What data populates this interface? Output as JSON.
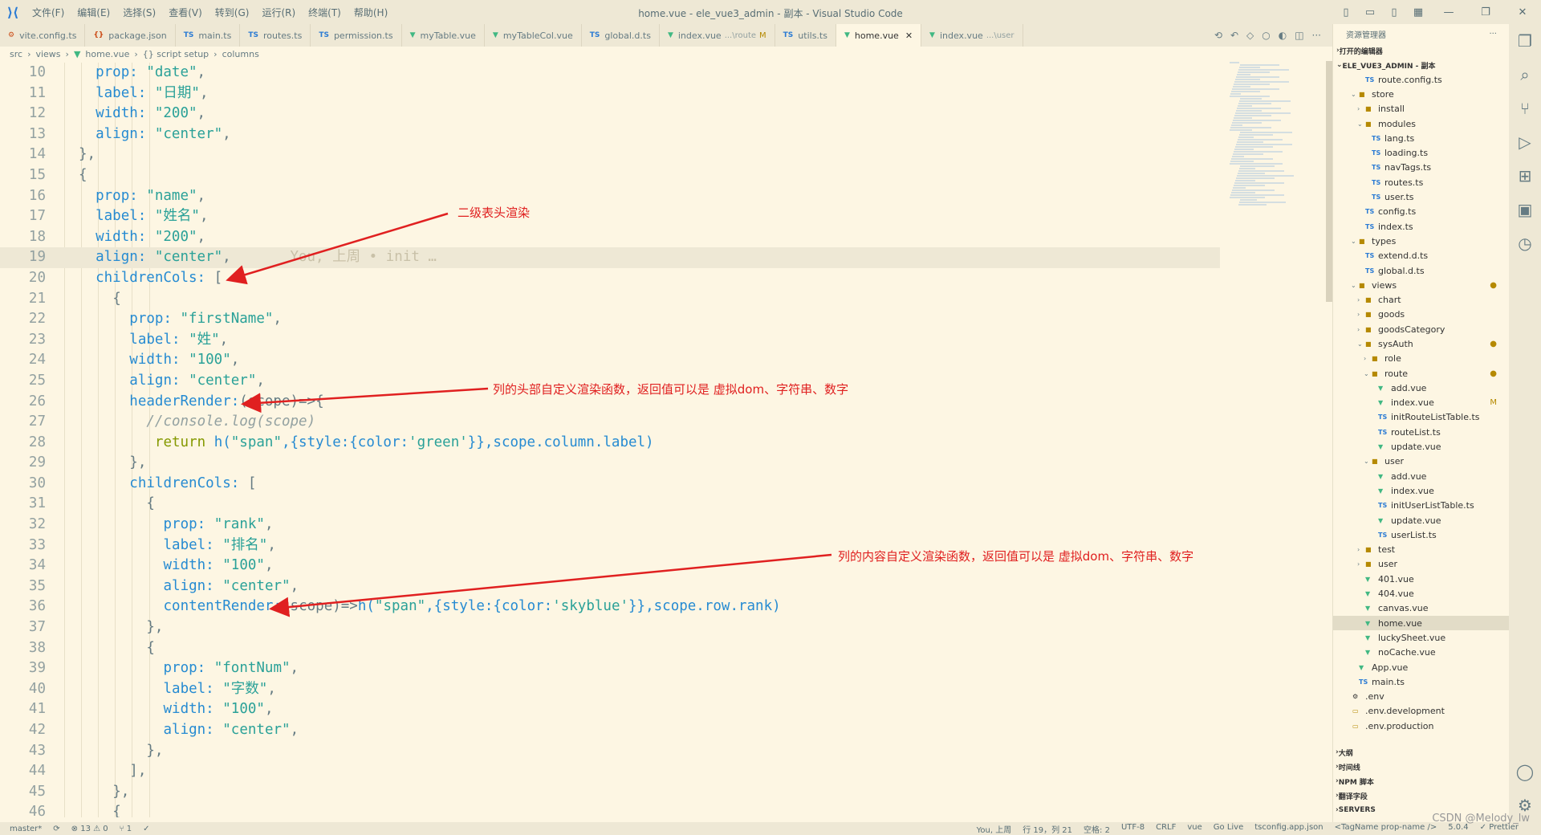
{
  "window": {
    "title": "home.vue - ele_vue3_admin - 副本 - Visual Studio Code",
    "menu": [
      "文件(F)",
      "编辑(E)",
      "选择(S)",
      "查看(V)",
      "转到(G)",
      "运行(R)",
      "终端(T)",
      "帮助(H)"
    ],
    "controls": {
      "minimize": "—",
      "maximize": "❐",
      "close": "✕"
    }
  },
  "tabs": [
    {
      "icon": "⚙",
      "name": "vite.config.ts",
      "sub": "",
      "mod": ""
    },
    {
      "icon": "{}",
      "name": "package.json",
      "sub": "",
      "mod": ""
    },
    {
      "icon": "TS",
      "name": "main.ts",
      "sub": "",
      "mod": ""
    },
    {
      "icon": "TS",
      "name": "routes.ts",
      "sub": "",
      "mod": ""
    },
    {
      "icon": "TS",
      "name": "permission.ts",
      "sub": "",
      "mod": ""
    },
    {
      "icon": "▼",
      "name": "myTable.vue",
      "sub": "",
      "mod": ""
    },
    {
      "icon": "▼",
      "name": "myTableCol.vue",
      "sub": "",
      "mod": ""
    },
    {
      "icon": "TS",
      "name": "global.d.ts",
      "sub": "",
      "mod": ""
    },
    {
      "icon": "▼",
      "name": "index.vue",
      "sub": "...\\route",
      "mod": "M"
    },
    {
      "icon": "TS",
      "name": "utils.ts",
      "sub": "",
      "mod": ""
    },
    {
      "icon": "▼",
      "name": "home.vue",
      "sub": "",
      "mod": "",
      "active": true,
      "close": "✕"
    },
    {
      "icon": "▼",
      "name": "index.vue",
      "sub": "...\\user",
      "mod": ""
    }
  ],
  "breadcrumb": [
    "src",
    "views",
    "home.vue",
    "{} script setup",
    "columns"
  ],
  "code": {
    "lines": [
      {
        "n": 10,
        "indent": 2,
        "tokens": [
          {
            "t": "prop: ",
            "c": "key"
          },
          {
            "t": "\"date\"",
            "c": "str"
          },
          {
            "t": ",",
            "c": "punc"
          }
        ]
      },
      {
        "n": 11,
        "indent": 2,
        "tokens": [
          {
            "t": "label: ",
            "c": "key"
          },
          {
            "t": "\"日期\"",
            "c": "str"
          },
          {
            "t": ",",
            "c": "punc"
          }
        ]
      },
      {
        "n": 12,
        "indent": 2,
        "tokens": [
          {
            "t": "width: ",
            "c": "key"
          },
          {
            "t": "\"200\"",
            "c": "str"
          },
          {
            "t": ",",
            "c": "punc"
          }
        ]
      },
      {
        "n": 13,
        "indent": 2,
        "tokens": [
          {
            "t": "align: ",
            "c": "key"
          },
          {
            "t": "\"center\"",
            "c": "str"
          },
          {
            "t": ",",
            "c": "punc"
          }
        ]
      },
      {
        "n": 14,
        "indent": 1,
        "tokens": [
          {
            "t": "},",
            "c": "punc"
          }
        ]
      },
      {
        "n": 15,
        "indent": 1,
        "tokens": [
          {
            "t": "{",
            "c": "punc"
          }
        ]
      },
      {
        "n": 16,
        "indent": 2,
        "tokens": [
          {
            "t": "prop: ",
            "c": "key"
          },
          {
            "t": "\"name\"",
            "c": "str"
          },
          {
            "t": ",",
            "c": "punc"
          }
        ]
      },
      {
        "n": 17,
        "indent": 2,
        "tokens": [
          {
            "t": "label: ",
            "c": "key"
          },
          {
            "t": "\"姓名\"",
            "c": "str"
          },
          {
            "t": ",",
            "c": "punc"
          }
        ]
      },
      {
        "n": 18,
        "indent": 2,
        "tokens": [
          {
            "t": "width: ",
            "c": "key"
          },
          {
            "t": "\"200\"",
            "c": "str"
          },
          {
            "t": ",",
            "c": "punc"
          }
        ]
      },
      {
        "n": 19,
        "indent": 2,
        "current": true,
        "tokens": [
          {
            "t": "align: ",
            "c": "key"
          },
          {
            "t": "\"center\"",
            "c": "str"
          },
          {
            "t": ",",
            "c": "punc"
          },
          {
            "t": "       You, 上周 • init …",
            "c": "ghost"
          }
        ]
      },
      {
        "n": 20,
        "indent": 2,
        "tokens": [
          {
            "t": "childrenCols: ",
            "c": "key"
          },
          {
            "t": "[",
            "c": "punc"
          }
        ]
      },
      {
        "n": 21,
        "indent": 3,
        "tokens": [
          {
            "t": "{",
            "c": "punc"
          }
        ]
      },
      {
        "n": 22,
        "indent": 4,
        "tokens": [
          {
            "t": "prop: ",
            "c": "key"
          },
          {
            "t": "\"firstName\"",
            "c": "str"
          },
          {
            "t": ",",
            "c": "punc"
          }
        ]
      },
      {
        "n": 23,
        "indent": 4,
        "tokens": [
          {
            "t": "label: ",
            "c": "key"
          },
          {
            "t": "\"姓\"",
            "c": "str"
          },
          {
            "t": ",",
            "c": "punc"
          }
        ]
      },
      {
        "n": 24,
        "indent": 4,
        "tokens": [
          {
            "t": "width: ",
            "c": "key"
          },
          {
            "t": "\"100\"",
            "c": "str"
          },
          {
            "t": ",",
            "c": "punc"
          }
        ]
      },
      {
        "n": 25,
        "indent": 4,
        "tokens": [
          {
            "t": "align: ",
            "c": "key"
          },
          {
            "t": "\"center\"",
            "c": "str"
          },
          {
            "t": ",",
            "c": "punc"
          }
        ]
      },
      {
        "n": 26,
        "indent": 4,
        "tokens": [
          {
            "t": "headerRender:",
            "c": "key"
          },
          {
            "t": "(scope)=>{",
            "c": "punc"
          }
        ]
      },
      {
        "n": 27,
        "indent": 5,
        "tokens": [
          {
            "t": "//console.log(scope)",
            "c": "cmt"
          }
        ]
      },
      {
        "n": 28,
        "indent": 5,
        "tokens": [
          {
            "t": " return ",
            "c": "kw"
          },
          {
            "t": "h(",
            "c": "fn"
          },
          {
            "t": "\"span\"",
            "c": "str"
          },
          {
            "t": ",{style:{color:",
            "c": "key"
          },
          {
            "t": "'green'",
            "c": "str"
          },
          {
            "t": "}},scope.column.label)",
            "c": "key"
          }
        ]
      },
      {
        "n": 29,
        "indent": 4,
        "tokens": [
          {
            "t": "},",
            "c": "punc"
          }
        ]
      },
      {
        "n": 30,
        "indent": 4,
        "tokens": [
          {
            "t": "childrenCols: ",
            "c": "key"
          },
          {
            "t": "[",
            "c": "punc"
          }
        ]
      },
      {
        "n": 31,
        "indent": 5,
        "tokens": [
          {
            "t": "{",
            "c": "punc"
          }
        ]
      },
      {
        "n": 32,
        "indent": 6,
        "tokens": [
          {
            "t": "prop: ",
            "c": "key"
          },
          {
            "t": "\"rank\"",
            "c": "str"
          },
          {
            "t": ",",
            "c": "punc"
          }
        ]
      },
      {
        "n": 33,
        "indent": 6,
        "tokens": [
          {
            "t": "label: ",
            "c": "key"
          },
          {
            "t": "\"排名\"",
            "c": "str"
          },
          {
            "t": ",",
            "c": "punc"
          }
        ]
      },
      {
        "n": 34,
        "indent": 6,
        "tokens": [
          {
            "t": "width: ",
            "c": "key"
          },
          {
            "t": "\"100\"",
            "c": "str"
          },
          {
            "t": ",",
            "c": "punc"
          }
        ]
      },
      {
        "n": 35,
        "indent": 6,
        "tokens": [
          {
            "t": "align: ",
            "c": "key"
          },
          {
            "t": "\"center\"",
            "c": "str"
          },
          {
            "t": ",",
            "c": "punc"
          }
        ]
      },
      {
        "n": 36,
        "indent": 6,
        "tokens": [
          {
            "t": "contentRender:",
            "c": "key"
          },
          {
            "t": "(scope)=>",
            "c": "punc"
          },
          {
            "t": "h(",
            "c": "fn"
          },
          {
            "t": "\"span\"",
            "c": "str"
          },
          {
            "t": ",{style:{color:",
            "c": "key"
          },
          {
            "t": "'skyblue'",
            "c": "str"
          },
          {
            "t": "}},scope.row.rank)",
            "c": "key"
          }
        ]
      },
      {
        "n": 37,
        "indent": 5,
        "tokens": [
          {
            "t": "},",
            "c": "punc"
          }
        ]
      },
      {
        "n": 38,
        "indent": 5,
        "tokens": [
          {
            "t": "{",
            "c": "punc"
          }
        ]
      },
      {
        "n": 39,
        "indent": 6,
        "tokens": [
          {
            "t": "prop: ",
            "c": "key"
          },
          {
            "t": "\"fontNum\"",
            "c": "str"
          },
          {
            "t": ",",
            "c": "punc"
          }
        ]
      },
      {
        "n": 40,
        "indent": 6,
        "tokens": [
          {
            "t": "label: ",
            "c": "key"
          },
          {
            "t": "\"字数\"",
            "c": "str"
          },
          {
            "t": ",",
            "c": "punc"
          }
        ]
      },
      {
        "n": 41,
        "indent": 6,
        "tokens": [
          {
            "t": "width: ",
            "c": "key"
          },
          {
            "t": "\"100\"",
            "c": "str"
          },
          {
            "t": ",",
            "c": "punc"
          }
        ]
      },
      {
        "n": 42,
        "indent": 6,
        "tokens": [
          {
            "t": "align: ",
            "c": "key"
          },
          {
            "t": "\"center\"",
            "c": "str"
          },
          {
            "t": ",",
            "c": "punc"
          }
        ]
      },
      {
        "n": 43,
        "indent": 5,
        "tokens": [
          {
            "t": "},",
            "c": "punc"
          }
        ]
      },
      {
        "n": 44,
        "indent": 4,
        "tokens": [
          {
            "t": "],",
            "c": "punc"
          }
        ]
      },
      {
        "n": 45,
        "indent": 3,
        "tokens": [
          {
            "t": "},",
            "c": "punc"
          }
        ]
      },
      {
        "n": 46,
        "indent": 3,
        "tokens": [
          {
            "t": "{",
            "c": "punc"
          }
        ]
      }
    ]
  },
  "annotations": {
    "a1": "二级表头渲染",
    "a2": "列的头部自定义渲染函数，返回值可以是 虚拟dom、字符串、数字",
    "a3": "列的内容自定义渲染函数，返回值可以是 虚拟dom、字符串、数字",
    "color": "#e02020"
  },
  "sidebar": {
    "title": "资源管理器",
    "more": "···",
    "open_editors": "打开的编辑器",
    "project": "ELE_VUE3_ADMIN - 副本",
    "tree": [
      {
        "d": 2,
        "type": "ts",
        "name": "route.config.ts"
      },
      {
        "d": 1,
        "type": "folder",
        "open": true,
        "name": "store"
      },
      {
        "d": 2,
        "type": "folder",
        "open": false,
        "name": "install"
      },
      {
        "d": 2,
        "type": "folder",
        "open": true,
        "name": "modules"
      },
      {
        "d": 3,
        "type": "ts",
        "name": "lang.ts"
      },
      {
        "d": 3,
        "type": "ts",
        "name": "loading.ts"
      },
      {
        "d": 3,
        "type": "ts",
        "name": "navTags.ts"
      },
      {
        "d": 3,
        "type": "ts",
        "name": "routes.ts"
      },
      {
        "d": 3,
        "type": "ts",
        "name": "user.ts"
      },
      {
        "d": 2,
        "type": "ts",
        "name": "config.ts"
      },
      {
        "d": 2,
        "type": "ts",
        "name": "index.ts"
      },
      {
        "d": 1,
        "type": "folder",
        "open": true,
        "name": "types"
      },
      {
        "d": 2,
        "type": "ts",
        "name": "extend.d.ts"
      },
      {
        "d": 2,
        "type": "ts",
        "name": "global.d.ts"
      },
      {
        "d": 1,
        "type": "folder",
        "open": true,
        "name": "views",
        "badge": "●"
      },
      {
        "d": 2,
        "type": "folder",
        "open": false,
        "name": "chart"
      },
      {
        "d": 2,
        "type": "folder",
        "open": false,
        "name": "goods"
      },
      {
        "d": 2,
        "type": "folder",
        "open": false,
        "name": "goodsCategory"
      },
      {
        "d": 2,
        "type": "folder",
        "open": true,
        "name": "sysAuth",
        "badge": "●"
      },
      {
        "d": 3,
        "type": "folder",
        "open": false,
        "name": "role"
      },
      {
        "d": 3,
        "type": "folder",
        "open": true,
        "name": "route",
        "badge": "●"
      },
      {
        "d": 4,
        "type": "vue",
        "name": "add.vue"
      },
      {
        "d": 4,
        "type": "vue",
        "name": "index.vue",
        "badge": "M"
      },
      {
        "d": 4,
        "type": "ts",
        "name": "initRouteListTable.ts"
      },
      {
        "d": 4,
        "type": "ts",
        "name": "routeList.ts"
      },
      {
        "d": 4,
        "type": "vue",
        "name": "update.vue"
      },
      {
        "d": 3,
        "type": "folder",
        "open": true,
        "name": "user"
      },
      {
        "d": 4,
        "type": "vue",
        "name": "add.vue"
      },
      {
        "d": 4,
        "type": "vue",
        "name": "index.vue"
      },
      {
        "d": 4,
        "type": "ts",
        "name": "initUserListTable.ts"
      },
      {
        "d": 4,
        "type": "vue",
        "name": "update.vue"
      },
      {
        "d": 4,
        "type": "ts",
        "name": "userList.ts"
      },
      {
        "d": 2,
        "type": "folder",
        "open": false,
        "name": "test"
      },
      {
        "d": 2,
        "type": "folder",
        "open": false,
        "name": "user"
      },
      {
        "d": 2,
        "type": "vue",
        "name": "401.vue"
      },
      {
        "d": 2,
        "type": "vue",
        "name": "404.vue"
      },
      {
        "d": 2,
        "type": "vue",
        "name": "canvas.vue"
      },
      {
        "d": 2,
        "type": "vue",
        "name": "home.vue",
        "selected": true
      },
      {
        "d": 2,
        "type": "vue",
        "name": "luckySheet.vue"
      },
      {
        "d": 2,
        "type": "vue",
        "name": "noCache.vue"
      },
      {
        "d": 1,
        "type": "vue",
        "name": "App.vue"
      },
      {
        "d": 1,
        "type": "ts",
        "name": "main.ts"
      },
      {
        "d": 0,
        "type": "gear",
        "name": ".env"
      },
      {
        "d": 0,
        "type": "file",
        "name": ".env.development"
      },
      {
        "d": 0,
        "type": "file",
        "name": ".env.production"
      }
    ],
    "bottom_sections": [
      "大纲",
      "时间线",
      "NPM 脚本",
      "翻译字段",
      "SERVERS"
    ]
  },
  "statusbar": {
    "branch": "master*",
    "sync": "⟳",
    "errors": "⊗ 13 ⚠ 0",
    "ports": "⑂ 1",
    "check": "✓",
    "blame": "You, 上周",
    "position": "行 19，列 21",
    "spaces": "空格: 2",
    "encoding": "UTF-8",
    "eol": "CRLF",
    "lang": "vue",
    "golive": "Go Live",
    "tsconfig": "tsconfig.app.json",
    "tag": "<TagName prop-name />",
    "version": "5.0.4",
    "prettier": "✓ Prettier",
    "watermark": "CSDN @Melody_lw"
  }
}
